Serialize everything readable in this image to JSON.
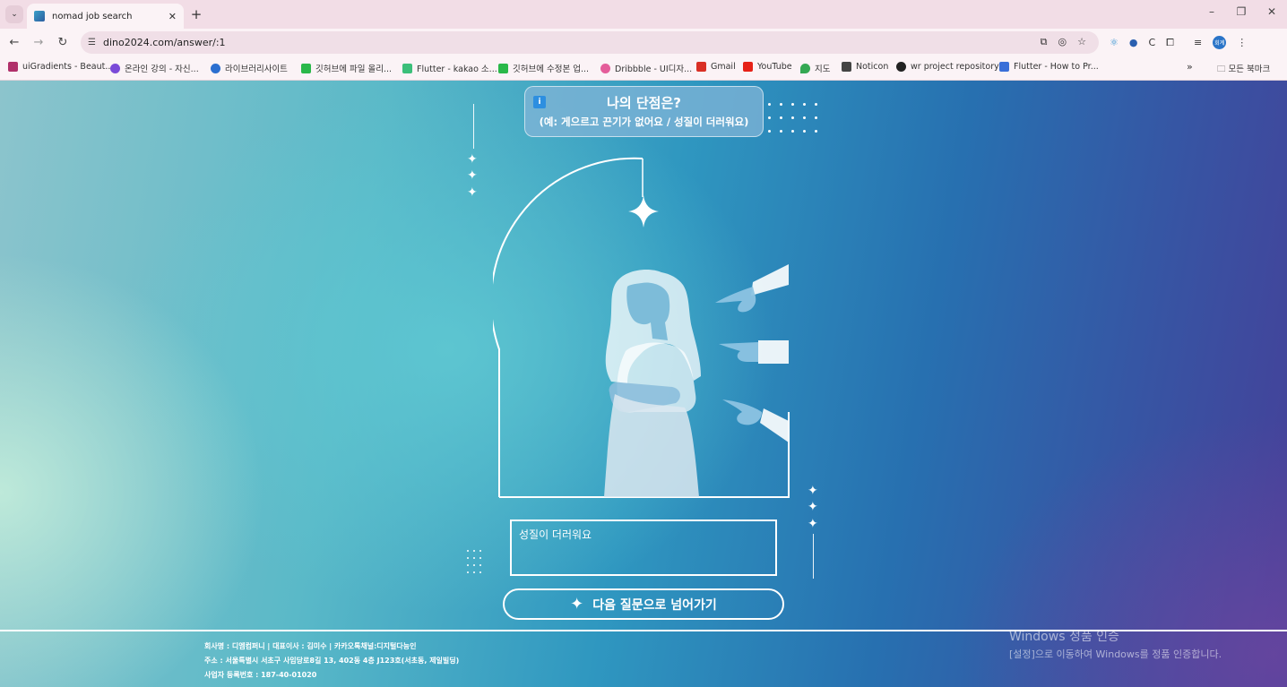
{
  "browser": {
    "tab_title": "nomad job search",
    "url": "dino2024.com/answer/:1",
    "profile_initials": "회계",
    "bookmarks": [
      {
        "label": "uiGradients - Beaut...",
        "color": "#b0306a"
      },
      {
        "label": "온라인 강의 - 자신...",
        "color": "#7a4ad8"
      },
      {
        "label": "라이브러리사이트",
        "color": "#2b6fd0"
      },
      {
        "label": "깃허브에 파일 올리...",
        "color": "#2ab84a"
      },
      {
        "label": "Flutter - kakao 소...",
        "color": "#3bbf7a"
      },
      {
        "label": "깃허브에 수정본 업...",
        "color": "#2ab84a"
      },
      {
        "label": "Dribbble - UI디자...",
        "color": "#e45d9a"
      },
      {
        "label": "Gmail",
        "color": "#d93025"
      },
      {
        "label": "YouTube",
        "color": "#e62117"
      },
      {
        "label": "지도",
        "color": "#34a853"
      },
      {
        "label": "Noticon",
        "color": "#444444"
      },
      {
        "label": "wr project repository",
        "color": "#222222"
      },
      {
        "label": "Flutter - How to Pr...",
        "color": "#3a6fd8"
      }
    ],
    "all_bookmarks_label": "모든 북마크"
  },
  "question": {
    "info_label": "i",
    "title": "나의 단점은?",
    "subtitle": "(예: 게으르고 끈기가 없어요 / 성질이 더러워요)"
  },
  "answer": {
    "value": "성질이 더러워요"
  },
  "next_button": {
    "label": "다음 질문으로 넘어가기"
  },
  "footer": {
    "line1": "회사명 : 디엠컴퍼니 | 대표이사 : 김미수 | 카카오톡채널:디지털다능인",
    "line2": "주소 : 서울특별시 서초구 사임당로8길 13, 402동 4층 J123호(서초동, 제일빌딩)",
    "line3": "사업자 등록번호 : 187-40-01020"
  },
  "watermark": {
    "line1": "Windows 정품 인증",
    "line2": "[설정]으로 이동하여 Windows를 정품 인증합니다."
  },
  "icons": [
    "tab-list-icon",
    "close-icon",
    "plus-icon",
    "minimize-icon",
    "restore-icon",
    "window-close-icon",
    "back-icon",
    "forward-icon",
    "reload-icon",
    "site-settings-icon",
    "install-icon",
    "eye-off-icon",
    "star-icon",
    "extension-icon",
    "menu-icon",
    "sparkle-icon",
    "info-icon",
    "folder-icon"
  ]
}
